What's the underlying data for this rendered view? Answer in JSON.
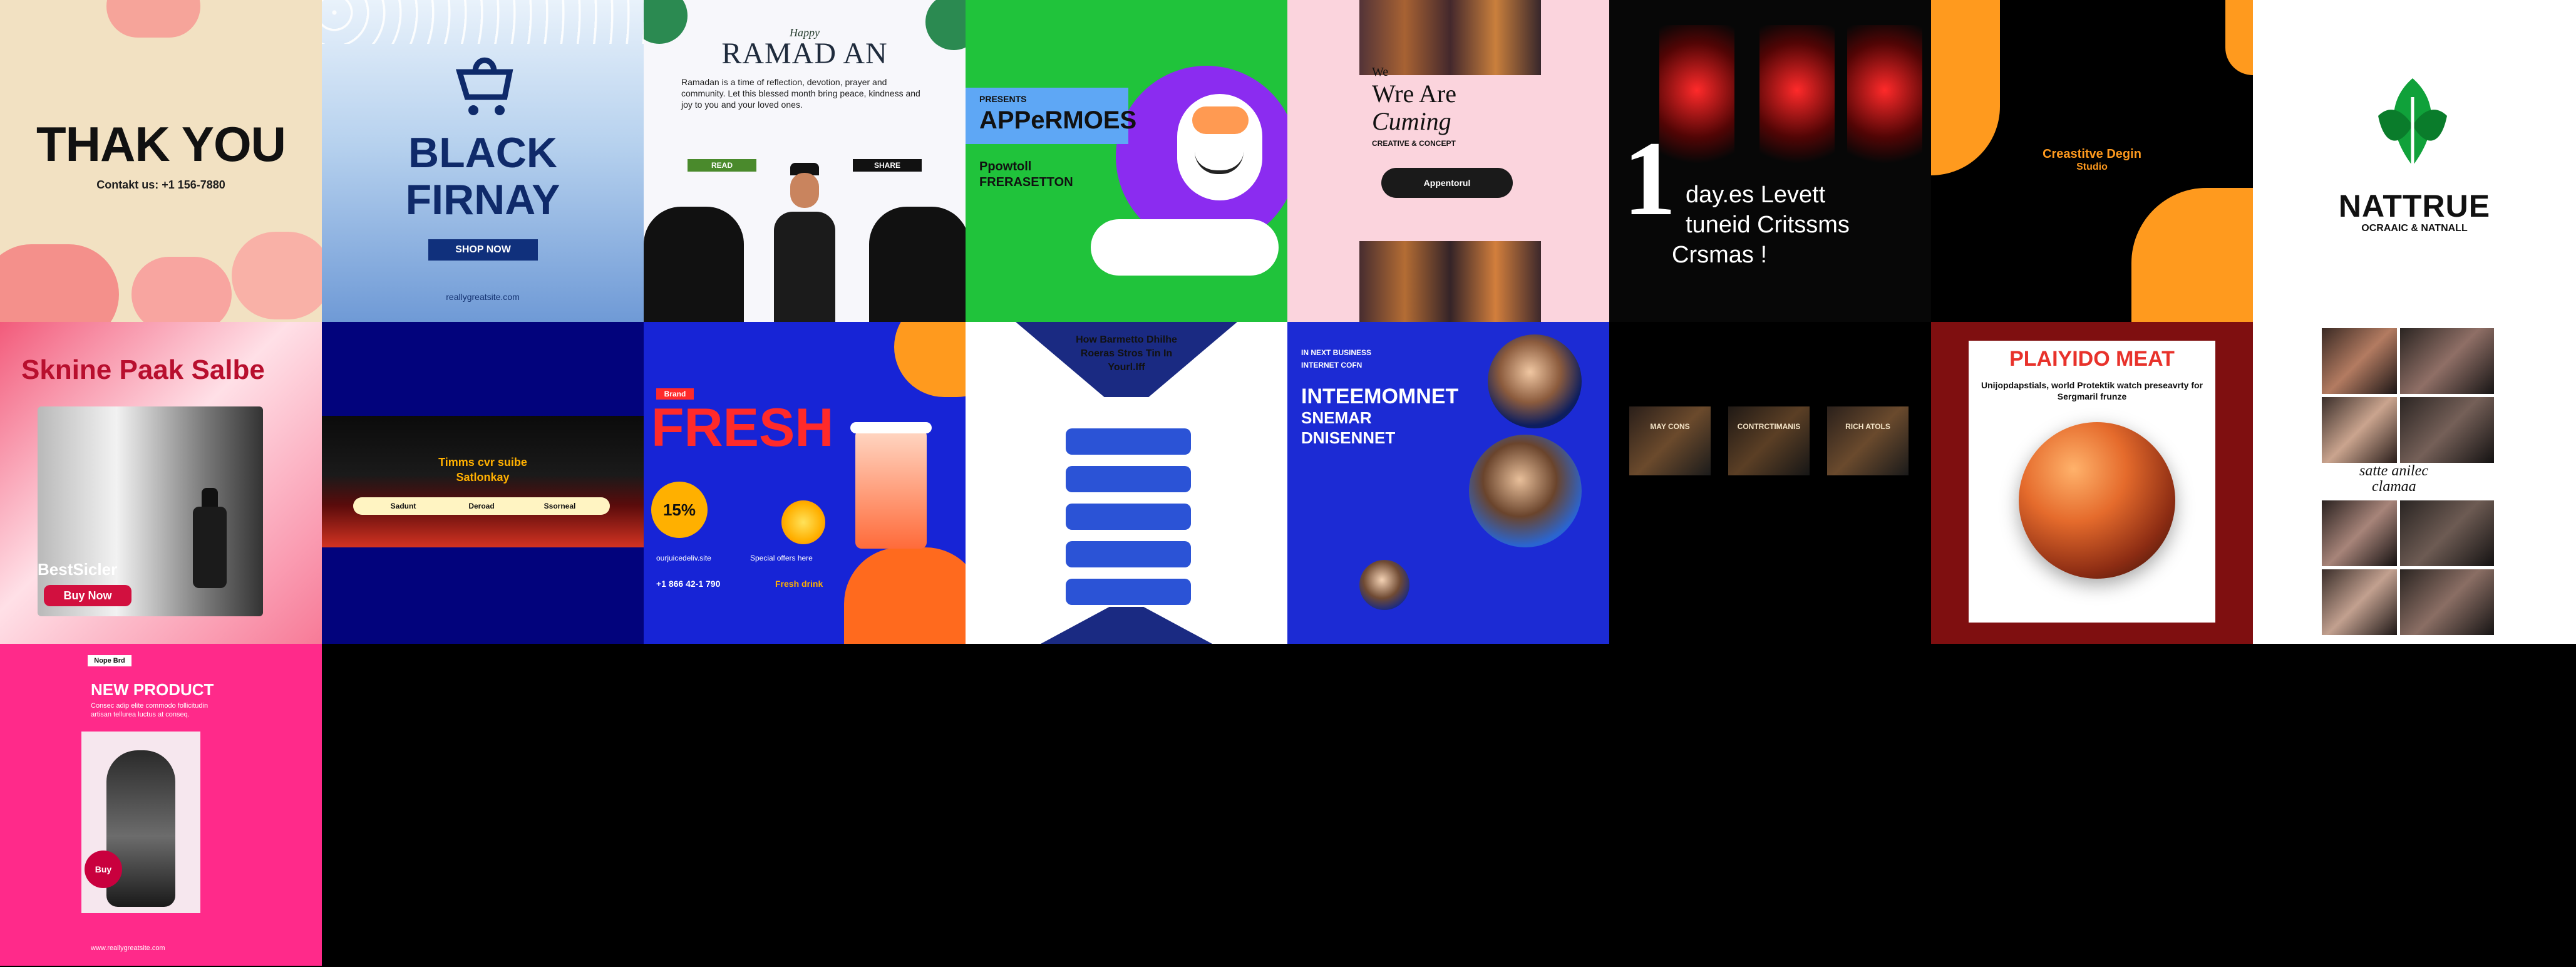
{
  "tiles": {
    "t1": {
      "title": "THAK YOU",
      "contact": "Contakt us:  +1 156-7880"
    },
    "t2": {
      "line1": "BLACK",
      "line2": "FIRNAY",
      "button": "SHOP NOW",
      "url": "reallygreatsite.com"
    },
    "t3": {
      "kicker": "Happy",
      "title": "RAMAD AN",
      "para": "Ramadan is a time of reflection, devotion, prayer and community. Let this blessed month bring peace, kindness and joy to you and your loved ones.",
      "btn_left": "READ",
      "btn_right": "SHARE"
    },
    "t4": {
      "kicker": "PRESENTS",
      "title": "APPeRMOES",
      "sub1": "Ppowtoll",
      "sub2": "FRERASETTON"
    },
    "t5": {
      "small": "We",
      "line1": "Wre Are",
      "line2": "Cuming",
      "sub": "CREATIVE & CONCEPT",
      "button": "Appentorul"
    },
    "t6": {
      "big": "1",
      "line1": "day.es Levett",
      "line2": "tuneid Critssms",
      "line3": "Crsmas !"
    },
    "t7": {
      "line1": "Creastitve Degin",
      "line2": "Studio"
    },
    "t8": {
      "title": "NATTRUE",
      "sub": "OCRAAIC & NATNALL"
    },
    "t9": {
      "title": "Sknine Paak  Salbe",
      "cta1": "BestSicler",
      "cta2": "Buy Now"
    },
    "t10": {
      "line1": "Timms cvr suibe",
      "line2": "Satlonkay",
      "chip1": "Sadunt",
      "chip2": "Deroad",
      "chip3": "Ssorneal"
    },
    "t11": {
      "tag": "Brand",
      "title": "FRESH",
      "badge": "15%",
      "note1": "ourjuicedeliv.site",
      "note2": "Special offers here",
      "phone": "+1 866 42-1 790",
      "cta": "Fresh drink"
    },
    "t12": {
      "line1": "How  Barmetto Dhilhe",
      "line2": "Roeras Stros  Tin In",
      "line3": "Yourl.Iff"
    },
    "t13": {
      "l1": "IN NEXT BUSINESS",
      "l2": "INTERNET COFN",
      "l3": "INTEEMOMNET",
      "l4": "SNEMAR",
      "l5": "DNISENNET"
    },
    "t14": {
      "col1": "MAY  CONS",
      "col2": "CONTRCTIMANIS",
      "col3": "RICH ATOLS"
    },
    "t15": {
      "title": "PLAIYIDO MEAT",
      "sub": "Unijopdapstials, world Protektik watch preseavrty for Sergmaril frunze"
    },
    "t16": {
      "line1": "satte anilec",
      "line2": "clamaa"
    },
    "t17": {
      "tag": "Nope Brd",
      "title": "NEW PRODUCT",
      "desc": "Consec adip elite commodo follicitudin artisan tellurea luctus at conseq.",
      "badge": "Buy",
      "footer": "www.reallygreatsite.com"
    }
  },
  "colors": {
    "cream": "#f5e6cc",
    "peach": "#f6a49a",
    "blueIce": "#a9c7e4",
    "navy": "#162f6d",
    "green": "#22c23a",
    "purple": "#8d2df0",
    "pinkLight": "#f9d4dc",
    "orange": "#ff9a1e",
    "royal": "#1a1ad8",
    "brick": "#8e1417",
    "hotpink": "#ff2a8a"
  }
}
